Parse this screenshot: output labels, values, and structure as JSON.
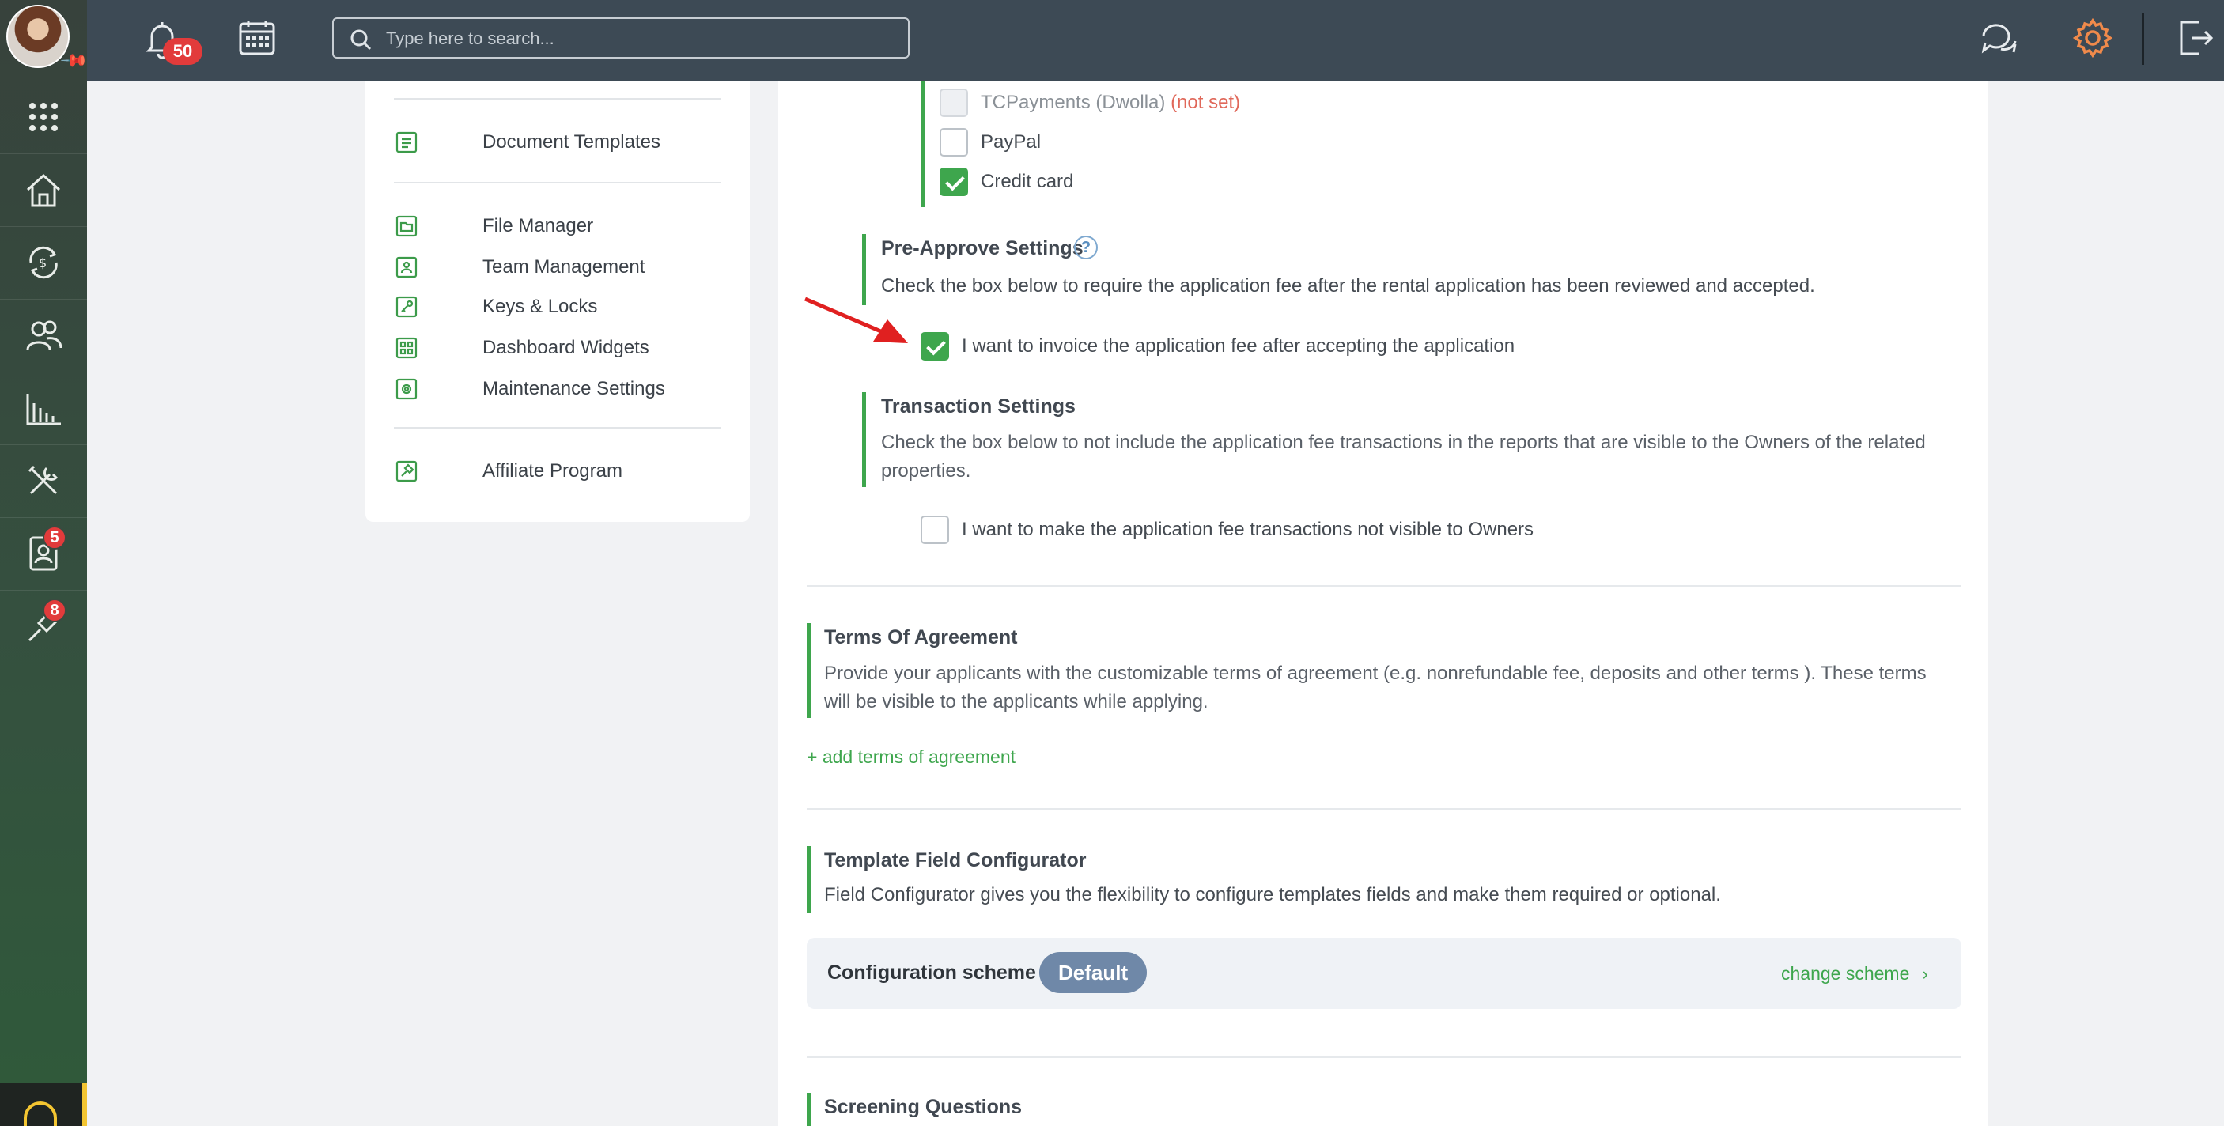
{
  "topbar": {
    "notifications_count": "50",
    "search_placeholder": "Type here to search..."
  },
  "sidebar": {
    "badges": {
      "applicants": "5",
      "affiliate": "8"
    }
  },
  "settings_menu": {
    "items": [
      "Document Templates",
      "File Manager",
      "Team Management",
      "Keys & Locks",
      "Dashboard Widgets",
      "Maintenance Settings",
      "Affiliate Program"
    ]
  },
  "payment_methods": {
    "tcpayments_label": "TCPayments (Dwolla)",
    "tcpayments_status": "(not set)",
    "paypal_label": "PayPal",
    "credit_card_label": "Credit card",
    "paypal_checked": false,
    "credit_card_checked": true
  },
  "pre_approve": {
    "title": "Pre-Approve Settings",
    "help_symbol": "?",
    "description": "Check the box below to require the application fee after the rental application has been reviewed and accepted.",
    "checkbox_label": "I want to invoice the application fee after accepting the application",
    "checked": true
  },
  "transaction": {
    "title": "Transaction Settings",
    "description": "Check the box below to not include the application fee transactions in the reports that are visible to the Owners of the related properties.",
    "checkbox_label": "I want to make the application fee transactions not visible to Owners",
    "checked": false
  },
  "terms": {
    "title": "Terms Of Agreement",
    "description": "Provide your applicants with the customizable terms of agreement (e.g. nonrefundable fee, deposits and other terms ). These terms will be visible to the applicants while applying.",
    "add_link": "+ add terms of agreement"
  },
  "template_config": {
    "title": "Template Field Configurator",
    "description": "Field Configurator gives you the flexibility to configure templates fields and make them required or optional.",
    "scheme_label": "Configuration scheme",
    "scheme_value": "Default",
    "change_link": "change scheme"
  },
  "screening": {
    "title": "Screening Questions"
  },
  "colors": {
    "accent_green": "#3ea64d",
    "topbar": "#3d4a55",
    "badge_red": "#e23b3b",
    "settings_orange": "#f08a4b",
    "arrow_red": "#e02020"
  }
}
